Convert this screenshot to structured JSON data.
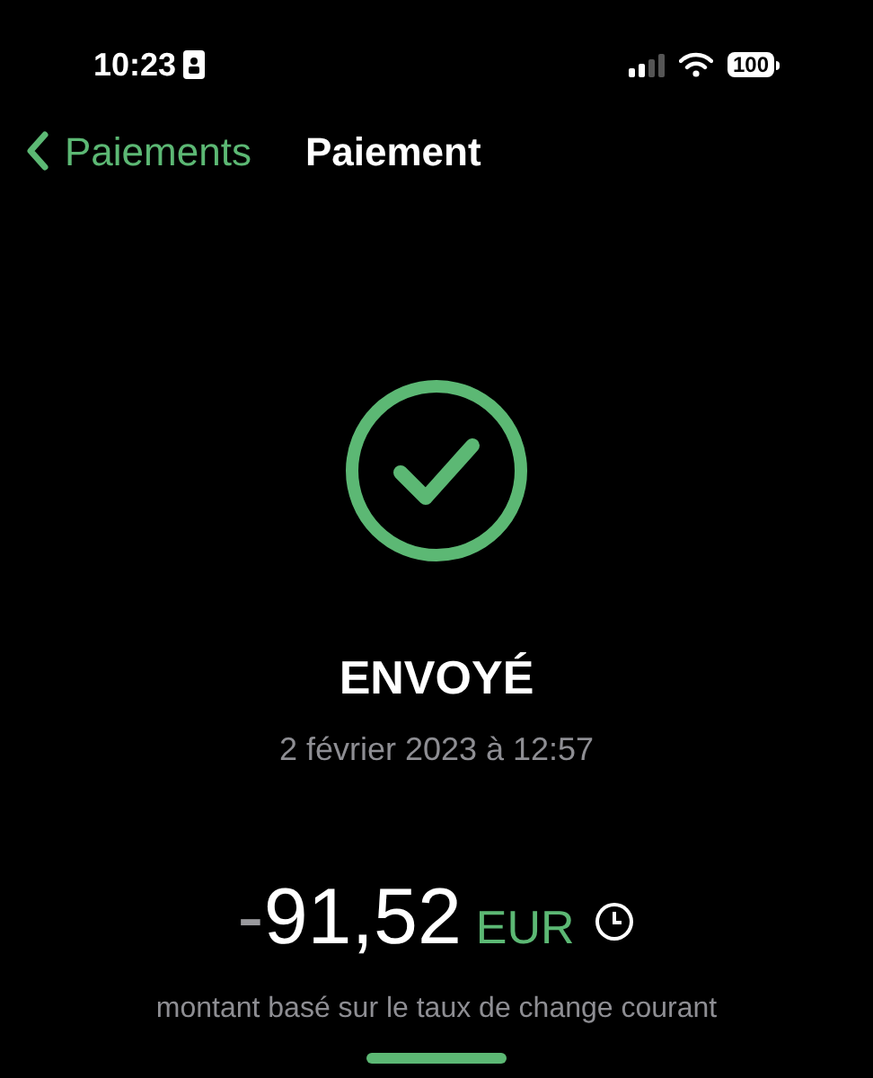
{
  "status_bar": {
    "time": "10:23",
    "battery": "100"
  },
  "nav": {
    "back_label": "Paiements",
    "title": "Paiement"
  },
  "status": {
    "label": "ENVOYÉ",
    "date": "2 février 2023 à 12:57"
  },
  "amount": {
    "sign": "-",
    "value": "91,52",
    "currency": "EUR",
    "caption": "montant basé sur le taux de change courant"
  }
}
